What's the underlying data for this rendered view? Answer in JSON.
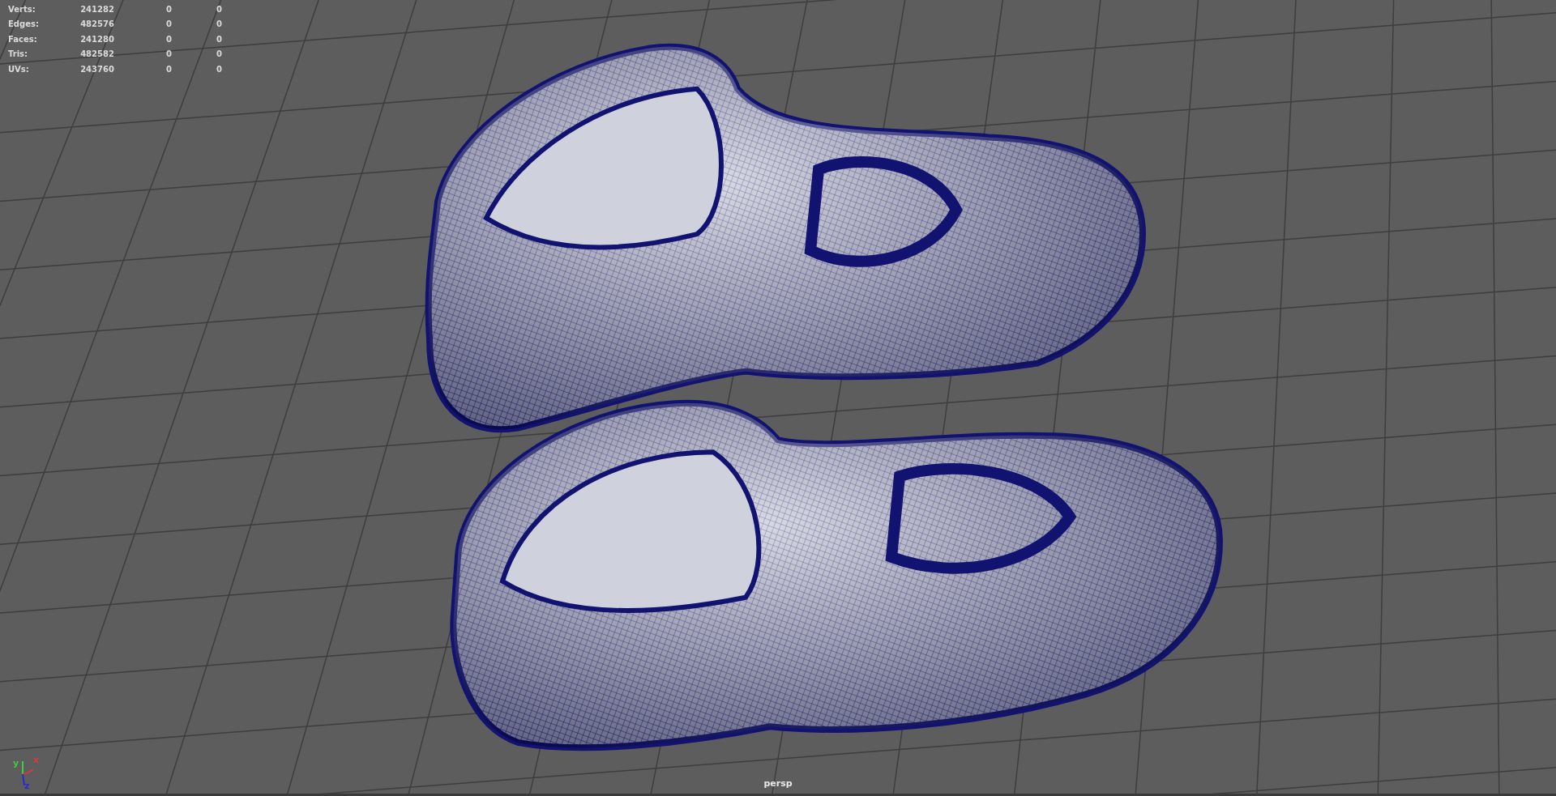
{
  "hud": {
    "rows": [
      {
        "label": "Verts:",
        "values": [
          "241282",
          "0",
          "0"
        ]
      },
      {
        "label": "Edges:",
        "values": [
          "482576",
          "0",
          "0"
        ]
      },
      {
        "label": "Faces:",
        "values": [
          "241280",
          "0",
          "0"
        ]
      },
      {
        "label": "Tris:",
        "values": [
          "482582",
          "0",
          "0"
        ]
      },
      {
        "label": "UVs:",
        "values": [
          "243760",
          "0",
          "0"
        ]
      }
    ]
  },
  "axes": [
    {
      "label": "y",
      "color": "#45c845"
    },
    {
      "label": "x",
      "color": "#d83a3a"
    },
    {
      "label": "z",
      "color": "#2a2ad0"
    }
  ],
  "camera_label": "persp"
}
